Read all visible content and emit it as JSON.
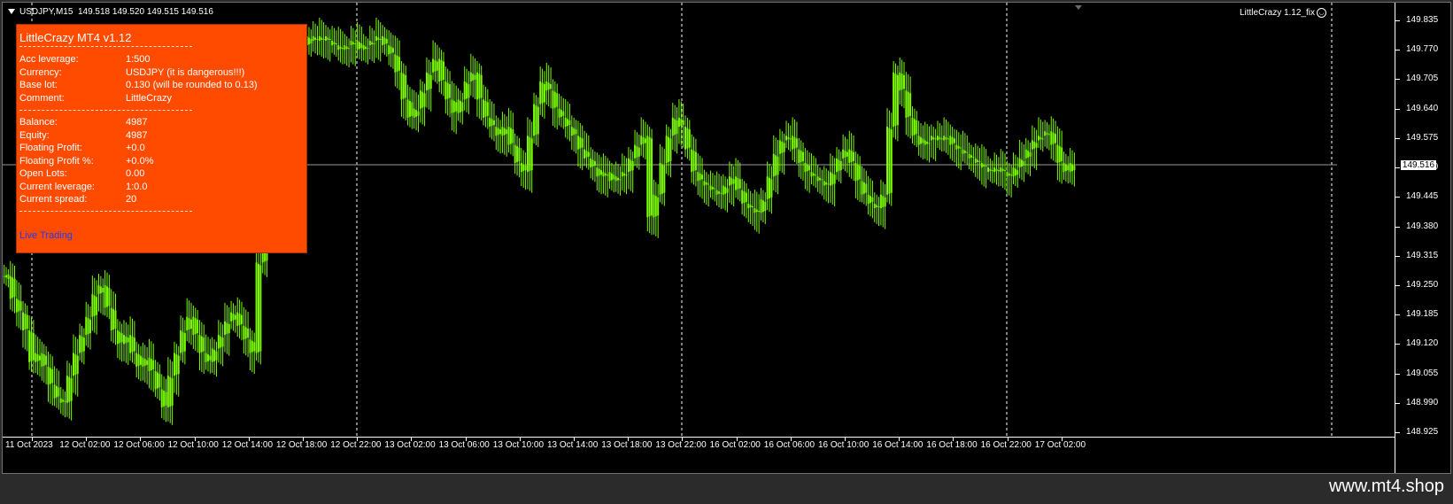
{
  "header": {
    "symbol": "USDJPY,M15",
    "ohlc": "149.518 149.520 149.515 149.516"
  },
  "ea_badge": {
    "label": "LittleCrazy 1.12_fix",
    "icon": "smile-icon"
  },
  "info_panel": {
    "title": "LittleCrazy MT4 v1.12",
    "separator": "--------------------------------------------",
    "rows_top": [
      {
        "key": "Acc leverage:",
        "value": "1:500"
      },
      {
        "key": "Currency:",
        "value": "USDJPY (it is dangerous!!!)"
      },
      {
        "key": "Base lot:",
        "value": "0.130 (will be rounded to 0.13)"
      },
      {
        "key": "Comment:",
        "value": "LittleCrazy"
      }
    ],
    "rows_bottom": [
      {
        "key": "Balance:",
        "value": "4987"
      },
      {
        "key": "Equity:",
        "value": "4987"
      },
      {
        "key": "Floating Profit:",
        "value": "+0.0"
      },
      {
        "key": "Floating Profit %:",
        "value": "+0.0%"
      },
      {
        "key": "Open Lots:",
        "value": "0.00"
      },
      {
        "key": "Current leverage:",
        "value": "1:0.0"
      },
      {
        "key": "Current spread:",
        "value": "20"
      }
    ],
    "live_label": "Live Trading",
    "colors": {
      "panel": "#ff4b00",
      "link": "#1a3cff"
    }
  },
  "price_scale": {
    "labels": [
      "149.835",
      "149.770",
      "149.705",
      "149.640",
      "149.575",
      "149.510",
      "149.445",
      "149.380",
      "149.315",
      "149.250",
      "149.185",
      "149.120",
      "149.055",
      "148.990",
      "148.925"
    ],
    "current": "149.516"
  },
  "time_axis": {
    "labels": [
      "11 Oct 2023",
      "12 Oct 02:00",
      "12 Oct 06:00",
      "12 Oct 10:00",
      "12 Oct 14:00",
      "12 Oct 18:00",
      "12 Oct 22:00",
      "13 Oct 02:00",
      "13 Oct 06:00",
      "13 Oct 10:00",
      "13 Oct 14:00",
      "13 Oct 18:00",
      "13 Oct 22:00",
      "16 Oct 02:00",
      "16 Oct 06:00",
      "16 Oct 10:00",
      "16 Oct 14:00",
      "16 Oct 18:00",
      "16 Oct 22:00",
      "17 Oct 02:00"
    ]
  },
  "footer": {
    "brand": "www.mt4.shop"
  },
  "chart_data": {
    "type": "line",
    "candle_color": "#7cfc00",
    "price_range": [
      148.925,
      149.835
    ],
    "current_price": 149.516,
    "close_series": [
      149.27,
      149.22,
      149.19,
      149.15,
      149.08,
      149.1,
      149.07,
      149.03,
      149.0,
      148.99,
      149.05,
      149.1,
      149.14,
      149.18,
      149.23,
      149.25,
      149.2,
      149.15,
      149.12,
      149.14,
      149.1,
      149.07,
      149.09,
      149.06,
      149.02,
      148.98,
      149.05,
      149.1,
      149.15,
      149.18,
      149.14,
      149.1,
      149.08,
      149.11,
      149.14,
      149.17,
      149.19,
      149.16,
      149.13,
      149.1,
      149.3,
      149.55,
      149.65,
      149.7,
      149.72,
      149.74,
      149.76,
      149.78,
      149.8,
      149.79,
      149.8,
      149.79,
      149.78,
      149.77,
      149.78,
      149.79,
      149.77,
      149.78,
      149.79,
      149.8,
      149.78,
      149.76,
      149.72,
      149.66,
      149.62,
      149.64,
      149.68,
      149.72,
      149.75,
      149.7,
      149.66,
      149.63,
      149.66,
      149.7,
      149.72,
      149.66,
      149.62,
      149.6,
      149.58,
      149.6,
      149.56,
      149.52,
      149.5,
      149.58,
      149.65,
      149.7,
      149.68,
      149.64,
      149.62,
      149.6,
      149.58,
      149.55,
      149.53,
      149.51,
      149.49,
      149.5,
      149.48,
      149.49,
      149.5,
      149.53,
      149.56,
      149.58,
      149.4,
      149.45,
      149.52,
      149.58,
      149.62,
      149.6,
      149.55,
      149.5,
      149.48,
      149.47,
      149.46,
      149.45,
      149.47,
      149.49,
      149.46,
      149.43,
      149.42,
      149.41,
      149.44,
      149.49,
      149.54,
      149.57,
      149.58,
      149.55,
      149.52,
      149.5,
      149.49,
      149.48,
      149.47,
      149.5,
      149.53,
      149.55,
      149.52,
      149.48,
      149.45,
      149.43,
      149.42,
      149.45,
      149.6,
      149.72,
      149.68,
      149.62,
      149.58,
      149.56,
      149.57,
      149.58,
      149.57,
      149.58,
      149.56,
      149.55,
      149.54,
      149.53,
      149.52,
      149.51,
      149.5,
      149.51,
      149.5,
      149.49,
      149.51,
      149.53,
      149.55,
      149.57,
      149.58,
      149.59,
      149.56,
      149.52,
      149.5,
      149.52
    ]
  }
}
